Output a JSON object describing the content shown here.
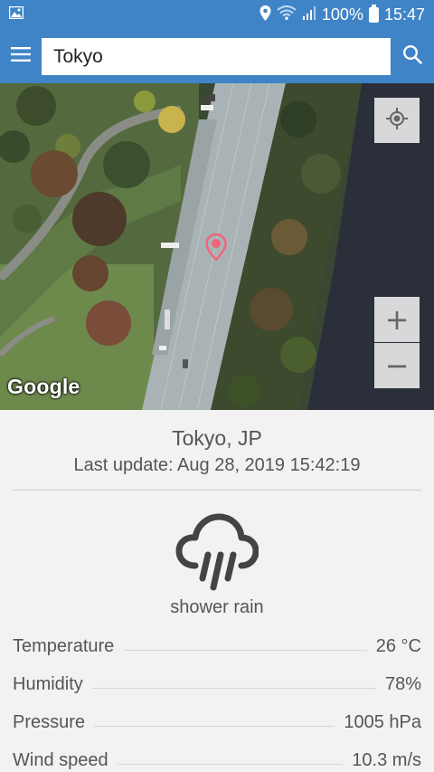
{
  "status_bar": {
    "battery_percent": "100%",
    "time": "15:47",
    "icons": [
      "image-icon",
      "location-icon",
      "wifi-icon",
      "signal-icon",
      "battery-icon"
    ]
  },
  "app_bar": {
    "menu_icon": "hamburger-menu-icon",
    "search_value": "Tokyo",
    "search_icon": "search-icon",
    "color": "#3f84c6"
  },
  "map": {
    "attribution": "Google",
    "zoom_in_label": "+",
    "zoom_out_label": "−",
    "locate_icon": "my-location-icon",
    "marker_icon": "map-pin-icon",
    "marker_color": "#f06478"
  },
  "weather": {
    "city": "Tokyo, JP",
    "last_update": "Last update: Aug 28, 2019 15:42:19",
    "icon": "shower-rain-icon",
    "description": "shower rain",
    "details": [
      {
        "label": "Temperature",
        "value": "26 °C"
      },
      {
        "label": "Humidity",
        "value": "78%"
      },
      {
        "label": "Pressure",
        "value": "1005 hPa"
      },
      {
        "label": "Wind speed",
        "value": "10.3 m/s"
      }
    ]
  }
}
